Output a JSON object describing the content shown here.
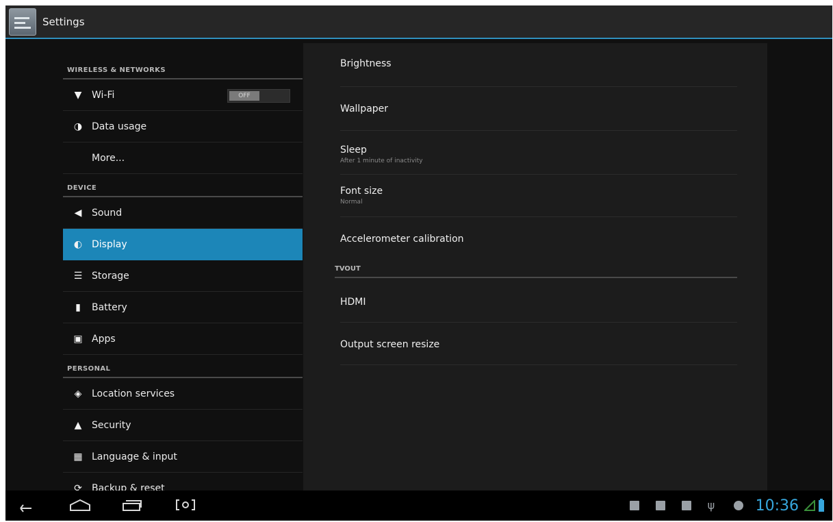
{
  "app": {
    "title": "Settings",
    "icon": "settings-app-icon"
  },
  "sidebar": {
    "sections": [
      {
        "header": "WIRELESS & NETWORKS",
        "items": [
          {
            "label": "Wi-Fi",
            "icon": "wifi-icon",
            "toggle": "OFF"
          },
          {
            "label": "Data usage",
            "icon": "data-usage-icon"
          },
          {
            "label": "More...",
            "icon": ""
          }
        ]
      },
      {
        "header": "DEVICE",
        "items": [
          {
            "label": "Sound",
            "icon": "speaker-icon"
          },
          {
            "label": "Display",
            "icon": "display-icon",
            "selected": true
          },
          {
            "label": "Storage",
            "icon": "storage-icon"
          },
          {
            "label": "Battery",
            "icon": "battery-icon"
          },
          {
            "label": "Apps",
            "icon": "apps-icon"
          }
        ]
      },
      {
        "header": "PERSONAL",
        "items": [
          {
            "label": "Location services",
            "icon": "location-icon"
          },
          {
            "label": "Security",
            "icon": "lock-icon"
          },
          {
            "label": "Language & input",
            "icon": "language-icon"
          },
          {
            "label": "Backup & reset",
            "icon": "backup-icon"
          }
        ]
      }
    ]
  },
  "display_panel": {
    "items": [
      {
        "title": "Brightness",
        "summary": ""
      },
      {
        "title": "Wallpaper",
        "summary": ""
      },
      {
        "title": "Sleep",
        "summary": "After 1 minute of inactivity"
      },
      {
        "title": "Font size",
        "summary": "Normal"
      },
      {
        "title": "Accelerometer calibration",
        "summary": ""
      }
    ],
    "tvout_header": "TVOUT",
    "tvout_items": [
      {
        "title": "HDMI"
      },
      {
        "title": "Output screen resize"
      }
    ]
  },
  "navbar": {
    "buttons": [
      "back-icon",
      "home-icon",
      "recent-apps-icon",
      "screenshot-icon"
    ],
    "status_icons": [
      "notification-icon",
      "image-icon",
      "notification-icon",
      "usb-icon",
      "android-icon"
    ],
    "time": "10:36",
    "accent": "#37a6dc"
  },
  "colors": {
    "accent": "#1c86b8",
    "divider": "#2f8fbd"
  }
}
